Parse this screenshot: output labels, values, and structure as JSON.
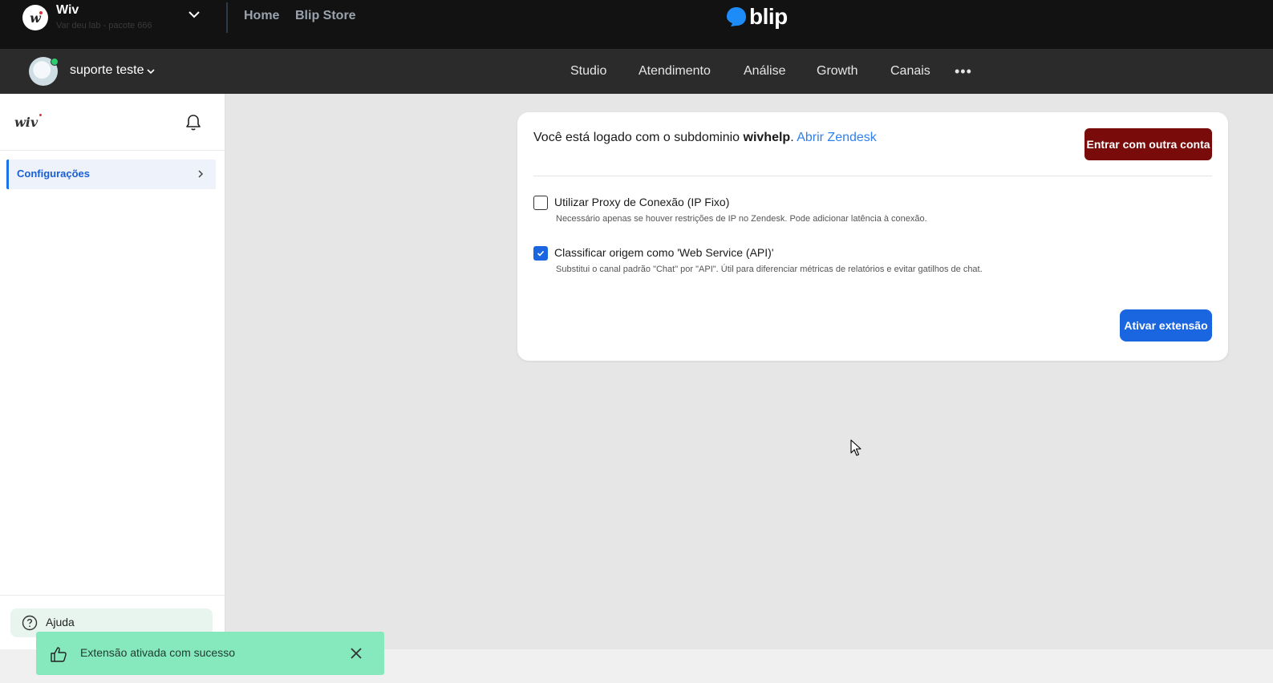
{
  "topbar": {
    "org_initial": "w",
    "org_name": "Wiv",
    "org_subtitle": "Var deu lab - pacote 666",
    "links": [
      "Home",
      "Blip Store"
    ],
    "brand": "blip"
  },
  "navbar": {
    "user_name": "suporte teste",
    "items": [
      "Studio",
      "Atendimento",
      "Análise",
      "Growth",
      "Canais"
    ],
    "more": "•••"
  },
  "sidebar": {
    "logo": "wiv",
    "items": [
      {
        "label": "Configurações",
        "active": true
      }
    ],
    "help_label": "Ajuda"
  },
  "card": {
    "status_prefix": "Você está logado com o subdominio ",
    "subdomain": "wivhelp",
    "status_suffix": ". ",
    "open_link": "Abrir Zendesk",
    "switch_account_label": "Entrar com outra conta",
    "options": [
      {
        "title": "Utilizar Proxy de Conexão (IP Fixo)",
        "description": "Necessário apenas se houver restrições de IP no Zendesk. Pode adicionar latência à conexão.",
        "checked": false
      },
      {
        "title": "Classificar origem como 'Web Service (API)'",
        "description": "Substitui o canal padrão \"Chat\" por \"API\". Útil para diferenciar métricas de relatórios e evitar gatilhos de chat.",
        "checked": true
      }
    ],
    "activate_label": "Ativar extensão"
  },
  "toast": {
    "message": "Extensão ativada com sucesso"
  },
  "colors": {
    "topbar_bg": "#121212",
    "navbar_bg": "#2b2b2b",
    "accent_blue": "#1a66e0",
    "danger_button": "#7a0b0b",
    "toast_bg": "#86e8bd"
  }
}
